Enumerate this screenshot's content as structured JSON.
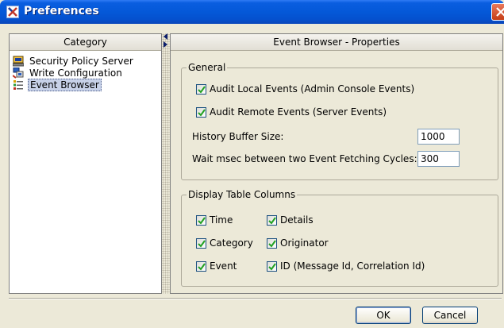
{
  "window": {
    "title": "Preferences"
  },
  "left_panel": {
    "header": "Category",
    "items": [
      {
        "label": "Security Policy Server",
        "icon": "server-icon",
        "selected": false
      },
      {
        "label": "Write Configuration",
        "icon": "write-config-icon",
        "selected": false
      },
      {
        "label": "Event Browser",
        "icon": "event-list-icon",
        "selected": true
      }
    ]
  },
  "right_panel": {
    "header": "Event Browser - Properties",
    "general": {
      "title": "General",
      "audit_local": {
        "label": "Audit Local Events (Admin Console Events)",
        "checked": true
      },
      "audit_remote": {
        "label": "Audit Remote Events (Server Events)",
        "checked": true
      },
      "history_buffer": {
        "label": "History Buffer Size:",
        "value": "1000"
      },
      "wait_msec": {
        "label": "Wait msec between two Event Fetching Cycles:",
        "value": "300"
      }
    },
    "columns": {
      "title": "Display Table Columns",
      "items": [
        {
          "label": "Time",
          "checked": true
        },
        {
          "label": "Details",
          "checked": true
        },
        {
          "label": "Category",
          "checked": true
        },
        {
          "label": "Originator",
          "checked": true
        },
        {
          "label": "Event",
          "checked": true
        },
        {
          "label": "ID (Message Id, Correlation Id)",
          "checked": true
        }
      ]
    }
  },
  "buttons": {
    "ok": "OK",
    "cancel": "Cancel"
  },
  "colors": {
    "titlebar": "#0458d8",
    "selection": "#c7d1e8",
    "face": "#ece9d8"
  }
}
